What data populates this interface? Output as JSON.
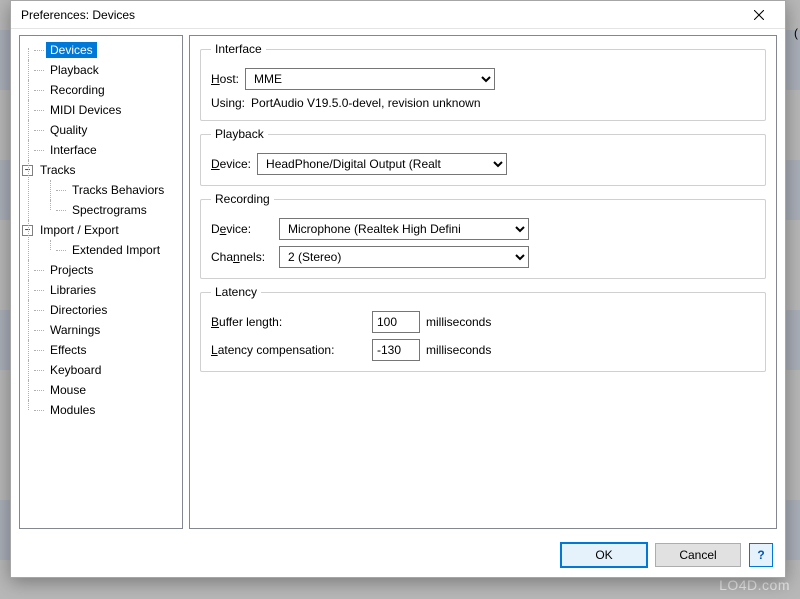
{
  "window": {
    "title": "Preferences: Devices"
  },
  "tree": {
    "items": [
      {
        "label": "Devices"
      },
      {
        "label": "Playback"
      },
      {
        "label": "Recording"
      },
      {
        "label": "MIDI Devices"
      },
      {
        "label": "Quality"
      },
      {
        "label": "Interface"
      },
      {
        "label": "Tracks"
      },
      {
        "label": "Tracks Behaviors"
      },
      {
        "label": "Spectrograms"
      },
      {
        "label": "Import / Export"
      },
      {
        "label": "Extended Import"
      },
      {
        "label": "Projects"
      },
      {
        "label": "Libraries"
      },
      {
        "label": "Directories"
      },
      {
        "label": "Warnings"
      },
      {
        "label": "Effects"
      },
      {
        "label": "Keyboard"
      },
      {
        "label": "Mouse"
      },
      {
        "label": "Modules"
      }
    ]
  },
  "groups": {
    "interface": {
      "legend": "Interface",
      "host_label_pre": "",
      "host_label": "ost:",
      "host_value": "MME",
      "using_label": "Using:",
      "using_value": "PortAudio V19.5.0-devel, revision unknown"
    },
    "playback": {
      "legend": "Playback",
      "device_label": "evice:",
      "device_value": "HeadPhone/Digital Output (Realt"
    },
    "recording": {
      "legend": "Recording",
      "device_label": "evice:",
      "device_value": "Microphone (Realtek High Defini",
      "channels_label": "Cha",
      "channels_label2": "nels:",
      "channels_value": "2 (Stereo)"
    },
    "latency": {
      "legend": "Latency",
      "buffer_label": "uffer length:",
      "buffer_value": "100",
      "ms": "milliseconds",
      "comp_label": "atency compensation:",
      "comp_value": "-130"
    }
  },
  "buttons": {
    "ok": "OK",
    "cancel": "Cancel",
    "help": "?"
  },
  "overlay": {
    "watermark": "LO4D.com",
    "paren": "("
  }
}
